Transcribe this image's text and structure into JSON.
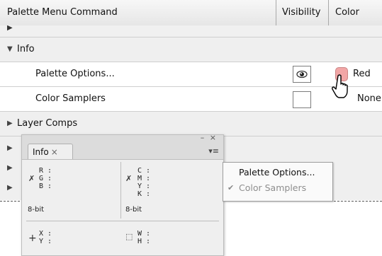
{
  "header": {
    "col_command": "Palette Menu Command",
    "col_visibility": "Visibility",
    "col_color": "Color"
  },
  "rows": {
    "info": {
      "label": "Info"
    },
    "palette_options": {
      "label": "Palette Options...",
      "color_label": "Red",
      "visible": true,
      "color_hex": "#f2a6a6"
    },
    "color_samplers": {
      "label": "Color Samplers",
      "color_label": "None",
      "visible": false
    },
    "layer_comps": {
      "label": "Layer Comps"
    }
  },
  "info_panel": {
    "tab_label": "Info",
    "rgb": {
      "r": "R :",
      "g": "G :",
      "b": "B :"
    },
    "cmyk": {
      "c": "C :",
      "m": "M :",
      "y": "Y :",
      "k": "K :"
    },
    "bit_left": "8-bit",
    "bit_right": "8-bit",
    "xy": {
      "x": "X :",
      "y": "Y :"
    },
    "wh": {
      "w": "W :",
      "h": "H :"
    }
  },
  "flyout_menu": {
    "item1": "Palette Options...",
    "item2": "Color Samplers",
    "item2_checked": true
  }
}
